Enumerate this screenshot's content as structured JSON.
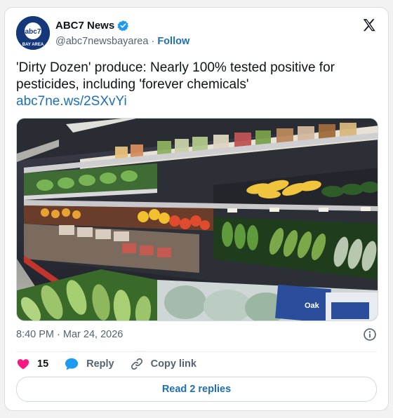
{
  "account": {
    "name": "ABC7 News",
    "handle": "@abc7newsbayarea",
    "separator": "·",
    "follow_label": "Follow",
    "avatar_text_top": "abc7",
    "avatar_text_bottom": "BAY AREA"
  },
  "tweet": {
    "text": "'Dirty Dozen' produce: Nearly 100% tested positive for pesticides, including 'forever chemicals'",
    "link": "abc7ne.ws/2SXvYi",
    "timestamp": "8:40 PM · Mar 24, 2026"
  },
  "actions": {
    "like_count": "15",
    "reply_label": "Reply",
    "copy_link_label": "Copy link",
    "read_replies_label": "Read 2 replies"
  },
  "media": {
    "package_label": "Oak"
  },
  "colors": {
    "brand_blue": "#1d6fb8",
    "verified_blue": "#1d9bf0",
    "like_pink": "#f91880",
    "avatar_bg": "#14387a"
  }
}
